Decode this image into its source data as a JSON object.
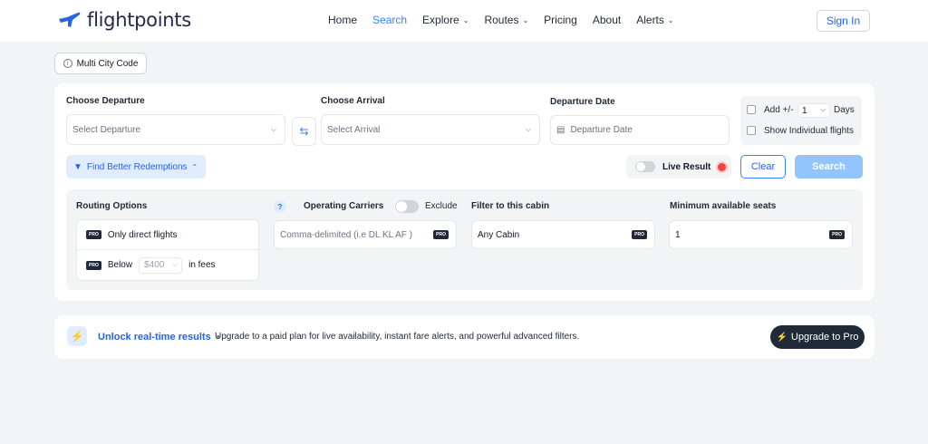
{
  "brand": {
    "name": "flightpoints",
    "accent": "#3b82f6"
  },
  "nav": {
    "items": [
      {
        "label": "Home",
        "dropdown": false,
        "active": false
      },
      {
        "label": "Search",
        "dropdown": false,
        "active": true
      },
      {
        "label": "Explore",
        "dropdown": true,
        "active": false
      },
      {
        "label": "Routes",
        "dropdown": true,
        "active": false
      },
      {
        "label": "Pricing",
        "dropdown": false,
        "active": false
      },
      {
        "label": "About",
        "dropdown": false,
        "active": false
      },
      {
        "label": "Alerts",
        "dropdown": true,
        "active": false
      }
    ],
    "sign_in": "Sign In"
  },
  "multi_city": {
    "label": "Multi City Code"
  },
  "search": {
    "departure": {
      "label": "Choose Departure",
      "placeholder": "Select Departure"
    },
    "arrival": {
      "label": "Choose Arrival",
      "placeholder": "Select Arrival"
    },
    "date": {
      "label": "Departure Date",
      "placeholder": "Departure Date"
    },
    "add_days": {
      "label_prefix": "Add +/-",
      "value": "1",
      "label_suffix": "Days"
    },
    "show_individual": "Show Individual flights",
    "find_better": "Find Better Redemptions",
    "live_result": "Live Result",
    "clear": "Clear",
    "search": "Search"
  },
  "advanced": {
    "routing": {
      "title": "Routing Options",
      "pro_badge": "PRO",
      "direct": "Only direct flights",
      "below_prefix": "Below",
      "below_value": "$400",
      "below_suffix": "in fees"
    },
    "help": "?",
    "carriers": {
      "title": "Operating Carriers",
      "exclude": "Exclude",
      "placeholder": "Comma-delimited (i.e DL KL AF )"
    },
    "cabin": {
      "title": "Filter to this cabin",
      "value": "Any Cabin"
    },
    "seats": {
      "title": "Minimum available seats",
      "value": "1"
    }
  },
  "banner": {
    "title": "Unlock real-time results",
    "separator": "•",
    "text": "Upgrade to a paid plan for live availability, instant fare alerts, and powerful advanced filters.",
    "button": "Upgrade to Pro"
  }
}
